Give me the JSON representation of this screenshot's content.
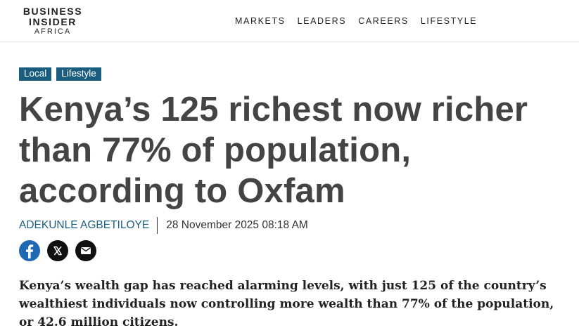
{
  "header": {
    "logo": {
      "line1": "BUSINESS",
      "line2": "INSIDER",
      "line3": "AFRICA"
    },
    "nav": [
      "MARKETS",
      "LEADERS",
      "CAREERS",
      "LIFESTYLE"
    ]
  },
  "article": {
    "tags": [
      "Local",
      "Lifestyle"
    ],
    "headline": "Kenya’s 125 richest now richer than 77% of population, according to Oxfam",
    "author": "ADEKUNLE AGBETILOYE",
    "date": "28 November 2025 08:18 AM",
    "social": [
      "facebook-icon",
      "x-icon",
      "email-icon"
    ],
    "lede": "Kenya’s wealth gap has reached alarming levels, with just 125 of the country’s wealthiest individuals now controlling more wealth than 77% of the population, or 42.6 million citizens."
  },
  "colors": {
    "accent": "#1b5d7f",
    "facebook": "#1f68b4",
    "headline": "#444444"
  }
}
